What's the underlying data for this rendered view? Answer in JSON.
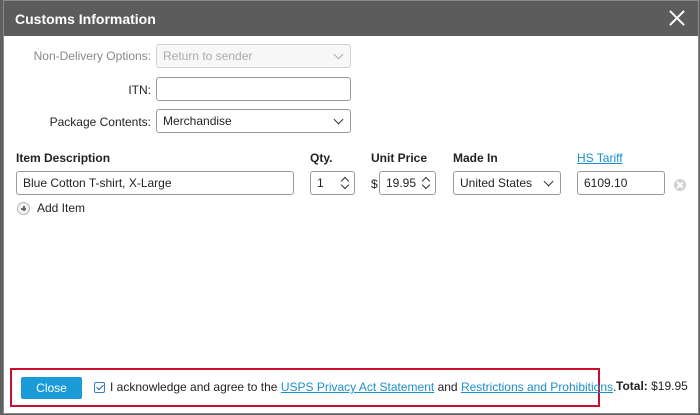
{
  "dialog": {
    "title": "Customs Information"
  },
  "form": {
    "non_delivery": {
      "label": "Non-Delivery Options:",
      "value": "Return to sender"
    },
    "itn": {
      "label": "ITN:",
      "value": ""
    },
    "package_contents": {
      "label": "Package Contents:",
      "value": "Merchandise"
    }
  },
  "items_table": {
    "headers": {
      "description": "Item Description",
      "qty": "Qty.",
      "unit_price": "Unit Price",
      "made_in": "Made In",
      "hs_tariff": "HS Tariff"
    },
    "rows": [
      {
        "description": "Blue Cotton T-shirt, X-Large",
        "qty": "1",
        "currency": "$",
        "unit_price": "19.95",
        "made_in": "United States",
        "hs_tariff": "6109.10"
      }
    ],
    "add_item_label": "Add Item"
  },
  "footer": {
    "close_label": "Close",
    "ack_prefix": "I acknowledge and agree to the",
    "privacy_link": "USPS Privacy Act Statement",
    "and_text": "and",
    "restrictions_link": "Restrictions and Prohibitions",
    "period": ".",
    "ack_checked": true,
    "total_label": "Total:",
    "total_value": "$19.95"
  },
  "colors": {
    "titlebar": "#5c5c5c",
    "primary_button": "#1a9bd7",
    "link": "#1a8fc9",
    "highlight_border": "#c8102e"
  }
}
